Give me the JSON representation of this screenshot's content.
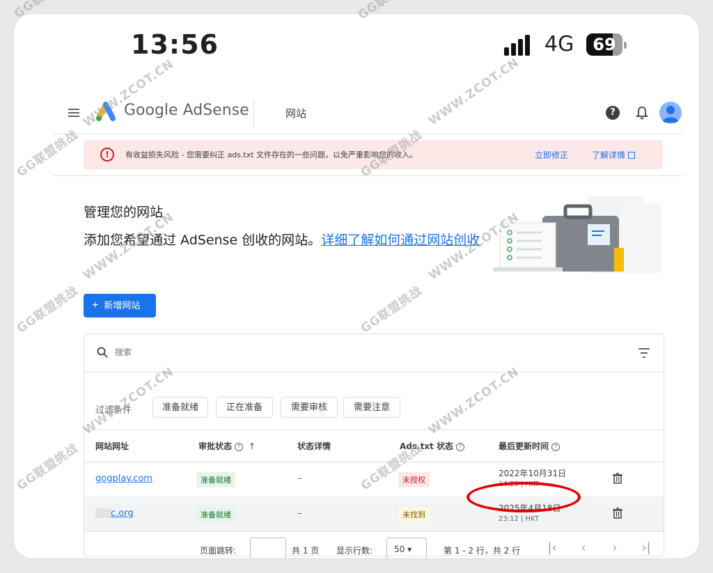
{
  "status_bar": {
    "time": "13:56",
    "network": "4G",
    "battery": "69"
  },
  "header": {
    "brand": "Google AdSense",
    "section_title": "网站"
  },
  "alert": {
    "text": "有收益损失风险 - 您需要纠正 ads.txt 文件存在的一些问题，以免严重影响您的收入。",
    "fix_label": "立即修正",
    "learn_label": "了解详情"
  },
  "manage": {
    "title": "管理您的网站",
    "desc": "添加您希望通过 AdSense 创收的网站。",
    "link": "详细了解如何通过网站创收",
    "add_button": "新增网站"
  },
  "search": {
    "placeholder": "搜索"
  },
  "filters": {
    "label": "过滤条件",
    "chips": [
      "准备就绪",
      "正在准备",
      "需要审核",
      "需要注意"
    ]
  },
  "table": {
    "columns": [
      "网站网址",
      "审批状态",
      "状态详情",
      "Ads.txt 状态",
      "最后更新时间"
    ],
    "rows": [
      {
        "site": "gogplay.com",
        "approval": "准备就绪",
        "details": "–",
        "ads_txt": "未授权",
        "date": "2022年10月31日",
        "time": "14:29 | HKT"
      },
      {
        "site": "c.org",
        "approval": "准备就绪",
        "details": "–",
        "ads_txt": "未找到",
        "date": "2025年4月18日",
        "time": "23:12 | HKT"
      }
    ]
  },
  "pager": {
    "jump_label": "页面跳转:",
    "pages_total": "共 1 页",
    "rows_label": "显示行数:",
    "rows_value": "50",
    "range": "第 1 - 2 行，共 2 行"
  },
  "watermarks": [
    "GG联盟挑战",
    "WWW.ZCOT.CN"
  ],
  "colors": {
    "primary": "#1a73e8",
    "alert_bg": "#fce8e6",
    "annotation": "#e00000"
  }
}
